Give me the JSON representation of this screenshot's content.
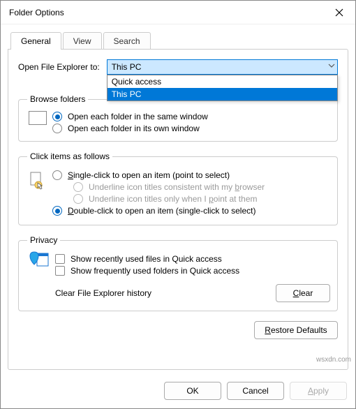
{
  "title": "Folder Options",
  "tabs": {
    "general": "General",
    "view": "View",
    "search": "Search"
  },
  "open_to": {
    "label": "Open File Explorer to:",
    "value": "This PC",
    "items": [
      "Quick access",
      "This PC"
    ]
  },
  "browse": {
    "legend": "Browse folders",
    "same": "Open each folder in the same window",
    "own": "Open each folder in its own window"
  },
  "click": {
    "legend": "Click items as follows",
    "single": "Single-click to open an item (point to select)",
    "underline_browser": "Underline icon titles consistent with my browser",
    "underline_point": "Underline icon titles only when I point at them",
    "double": "Double-click to open an item (single-click to select)"
  },
  "privacy": {
    "legend": "Privacy",
    "recent": "Show recently used files in Quick access",
    "frequent": "Show frequently used folders in Quick access",
    "clear_label": "Clear File Explorer history",
    "clear_btn": "Clear"
  },
  "restore": "Restore Defaults",
  "buttons": {
    "ok": "OK",
    "cancel": "Cancel",
    "apply": "Apply"
  },
  "watermark": "wsxdn.com"
}
